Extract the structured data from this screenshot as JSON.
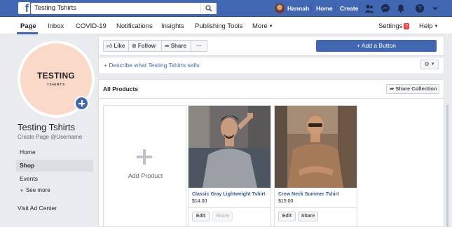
{
  "topbar": {
    "search_value": "Testing Tshirts",
    "user_name": "Hannah",
    "home_label": "Home",
    "create_label": "Create"
  },
  "pagenav": {
    "tabs": [
      "Page",
      "Inbox",
      "COVID-19",
      "Notifications",
      "Insights",
      "Publishing Tools",
      "More"
    ],
    "settings_label": "Settings",
    "settings_badge": "2",
    "help_label": "Help"
  },
  "profile": {
    "pic_title": "TESTING",
    "pic_subtitle": "TSHIRTS",
    "page_name": "Testing Tshirts",
    "handle_text": "Create Page @Username"
  },
  "leftnav": {
    "items": [
      "Home",
      "Shop",
      "Events"
    ],
    "see_more": "See more",
    "visit_ad": "Visit Ad Center"
  },
  "actions": {
    "like": "Like",
    "follow": "Follow",
    "share": "Share",
    "more": "···",
    "cta": "+ Add a Button",
    "describe": "+ Describe what Testing Tshirts sells"
  },
  "products": {
    "section_title": "All Products",
    "share_collection": "Share Collection",
    "add_product": "Add Product",
    "items": [
      {
        "name": "Classic Gray Lightweight Tshirt",
        "price": "$14.00"
      },
      {
        "name": "Crew Neck Summer Tshirt",
        "price": "$15.00"
      }
    ],
    "edit_label": "Edit",
    "share_label": "Share"
  },
  "colors": {
    "brand_blue": "#4267b2",
    "nav_bg": "#ffffff",
    "page_bg": "#e9ebee",
    "badge_red": "#fa3e3e",
    "profile_peach": "#fbd9c9"
  },
  "icons": [
    "facebook-logo-icon",
    "search-icon",
    "friends-icon",
    "messenger-icon",
    "bell-icon",
    "help-icon",
    "caret-down-icon",
    "like-icon",
    "follow-icon",
    "share-icon",
    "gear-icon",
    "plus-icon"
  ]
}
